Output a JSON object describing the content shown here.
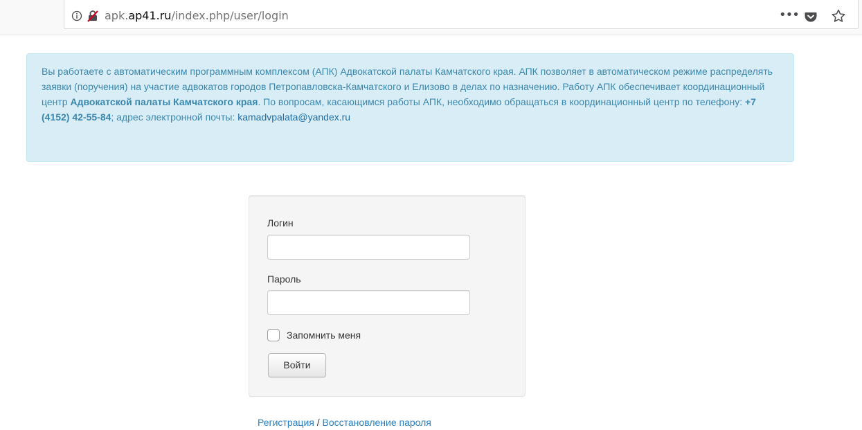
{
  "browser": {
    "url_prefix": "apk.",
    "url_domain": "ap41.ru",
    "url_path": "/index.php/user/login",
    "more_label": "•••"
  },
  "alert": {
    "part1": "Вы работаете с автоматическим программным комплексом (АПК) Адвокатской палаты Камчатского края. АПК позволяет в автоматическом режиме распределять заявки (поручения) на участие адвокатов городов Петропавловска-Камчатского и Елизово в делах по назначению. Работу АПК обеспечивает координационный центр ",
    "org_name": "Адвокатской палаты Камчатского края",
    "part2": ". По вопросам, касающимся работы АПК, необходимо обращаться в координационный центр по телефону: ",
    "phone": "+7 (4152) 42-55-84",
    "part3": "; адрес электронной почты: ",
    "email": "kamadvpalata@yandex.ru"
  },
  "login_form": {
    "login_label": "Логин",
    "login_value": "",
    "password_label": "Пароль",
    "password_value": "",
    "remember_label": "Запомнить меня",
    "remember_checked": false,
    "submit_label": "Войти"
  },
  "links": {
    "register": "Регистрация",
    "separator": " / ",
    "recover": "Восстановление пароля"
  },
  "colors": {
    "alert_bg": "#d9edf7",
    "alert_text": "#3a87ad",
    "link": "#2a82c4",
    "well_bg": "#f5f5f5"
  }
}
